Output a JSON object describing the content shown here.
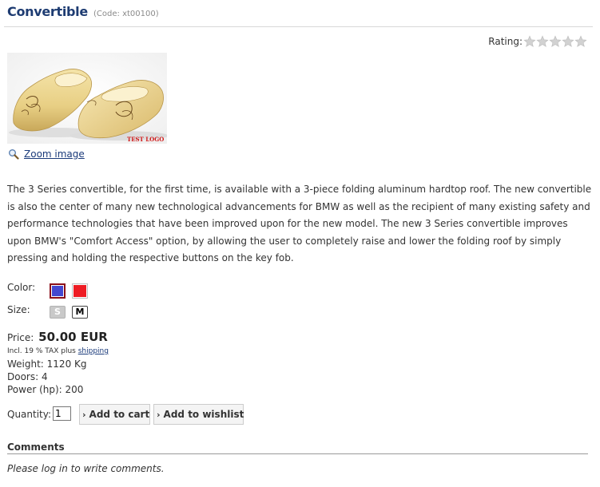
{
  "product": {
    "title": "Convertible",
    "code": "(Code: xt00100)",
    "rating_label": "Rating:",
    "rating_value": 0,
    "rating_max": 5,
    "image_watermark": "TEST LOGO",
    "zoom_label": "Zoom image",
    "description": "The 3 Series convertible, for the first time, is available with a 3-piece folding aluminum hardtop roof. The new convertible is also the center of many new technological advancements for BMW as well as the recipient of many existing safety and performance technologies that have been improved upon for the new model. The new 3 Series convertible improves upon BMW's \"Comfort Access\" option, by allowing the user to completely raise and lower the folding roof by simply pressing and holding the respective buttons on the key fob."
  },
  "options": {
    "color_label": "Color:",
    "colors": [
      {
        "name": "blue",
        "hex": "#4448d0",
        "selected": true
      },
      {
        "name": "red",
        "hex": "#ee1c24",
        "selected": false
      }
    ],
    "size_label": "Size:",
    "sizes": [
      {
        "label": "S",
        "available": false
      },
      {
        "label": "M",
        "available": true
      }
    ]
  },
  "pricing": {
    "price_label": "Price:",
    "price": "50.00 EUR",
    "tax_prefix": "Incl. 19 % TAX plus",
    "shipping_link": "shipping"
  },
  "specs": [
    "Weight: 1120 Kg",
    "Doors: 4",
    "Power (hp): 200"
  ],
  "cart": {
    "quantity_label": "Quantity:",
    "quantity_value": "1",
    "add_to_cart": "Add to cart",
    "add_to_wishlist": "Add to wishlist"
  },
  "comments": {
    "heading": "Comments",
    "login_note": "Please log in to write comments."
  },
  "colors": {
    "title": "#1e3c72",
    "link": "#1a3a7a",
    "star_empty": "#cfcfcf"
  }
}
